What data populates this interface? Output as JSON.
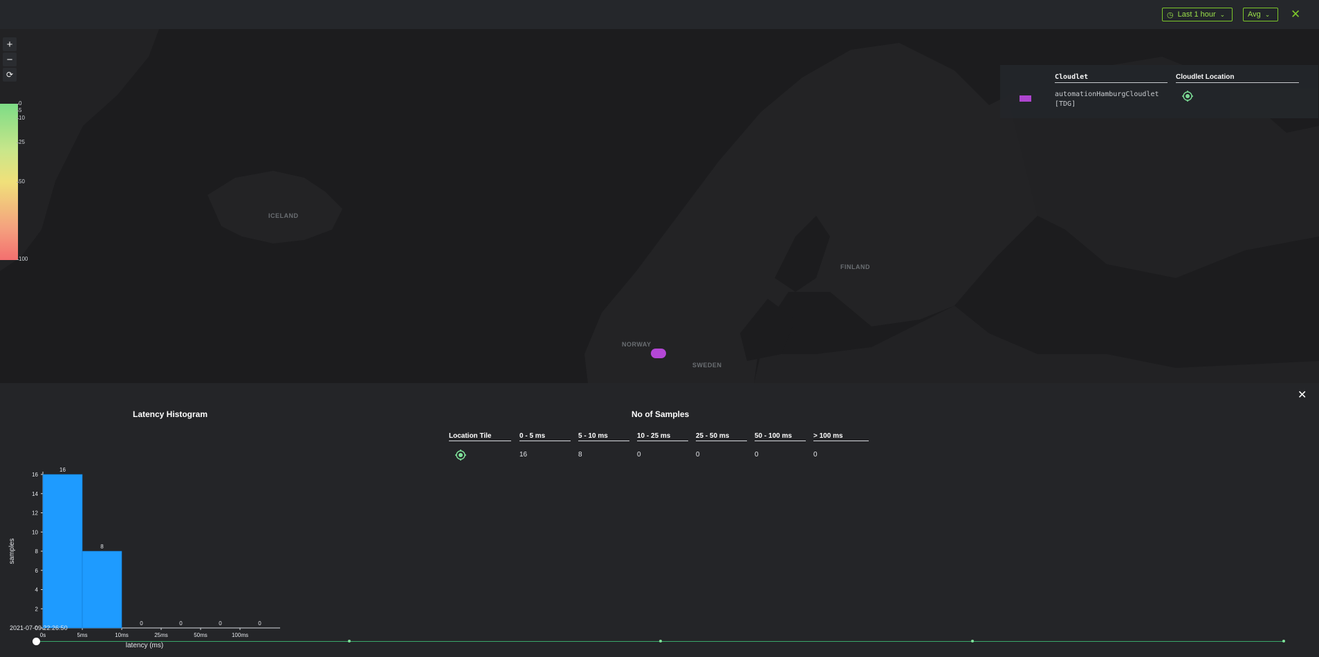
{
  "toolbar": {
    "time_range_label": "Last 1 hour",
    "aggregation_label": "Avg",
    "accent": "#7cc72a"
  },
  "map": {
    "zoom_in": "+",
    "zoom_out": "−",
    "reset": "⟳",
    "latency_legend": [
      "0",
      "5",
      "10",
      "25",
      "50",
      "100"
    ],
    "labels": [
      "ICELAND",
      "NORWAY",
      "SWEDEN",
      "FINLAND"
    ]
  },
  "cloudlet_panel": {
    "col_cloudlet": "Cloudlet",
    "col_location": "Cloudlet Location",
    "cloudlet_name_line1": "automationHamburgCloudlet",
    "cloudlet_name_line2": "[TDG]",
    "marker_color": "#b447d6"
  },
  "histogram": {
    "title": "Latency Histogram"
  },
  "samples": {
    "title": "No of Samples",
    "headers": [
      "Location Tile",
      "0 - 5 ms",
      "5 - 10 ms",
      "10 - 25 ms",
      "25 - 50 ms",
      "50 - 100 ms",
      "> 100 ms"
    ],
    "values": [
      "16",
      "8",
      "0",
      "0",
      "0",
      "0"
    ]
  },
  "timeline": {
    "timestamp": "2021-07-09 22:26:50"
  },
  "chart_data": {
    "type": "bar",
    "title": "Latency Histogram",
    "xlabel": "latency (ms)",
    "ylabel": "samples",
    "categories": [
      "0s-5ms",
      "5ms-10ms",
      "10ms-25ms",
      "25ms-50ms",
      "50ms-100ms",
      ">100ms"
    ],
    "x_ticks": [
      "0s",
      "5ms",
      "10ms",
      "25ms",
      "50ms",
      "100ms"
    ],
    "values": [
      16,
      8,
      0,
      0,
      0,
      0
    ],
    "value_labels": [
      "16",
      "8",
      "0",
      "0",
      "0",
      "0"
    ],
    "y_ticks": [
      "0",
      "2",
      "4",
      "6",
      "8",
      "10",
      "12",
      "14",
      "16"
    ],
    "ylim": [
      0,
      16
    ],
    "bar_color": "#1e9bff",
    "grid": false,
    "legend": "none"
  }
}
